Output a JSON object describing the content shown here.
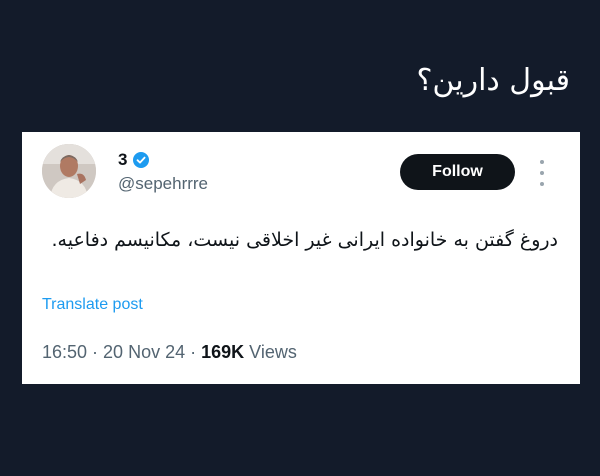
{
  "caption": "قبول دارین؟",
  "tweet": {
    "display_name": "3",
    "handle": "@sepehrrre",
    "follow_label": "Follow",
    "text": "دروغ گفتن به خانواده ایرانی غیر اخلاقی نیست، مکانیسم دفاعیه.",
    "translate_label": "Translate post",
    "time": "16:50",
    "separator_1": " · ",
    "date": "20 Nov 24",
    "separator_2": " · ",
    "views_count": "169K",
    "views_label": " Views"
  },
  "colors": {
    "background": "#131b2a",
    "follow_button": "#0f1419",
    "link": "#1d9bf0",
    "verified": "#1d9bf0",
    "muted": "#536471"
  },
  "icons": [
    "verified-badge-icon",
    "more-options-icon",
    "avatar"
  ]
}
